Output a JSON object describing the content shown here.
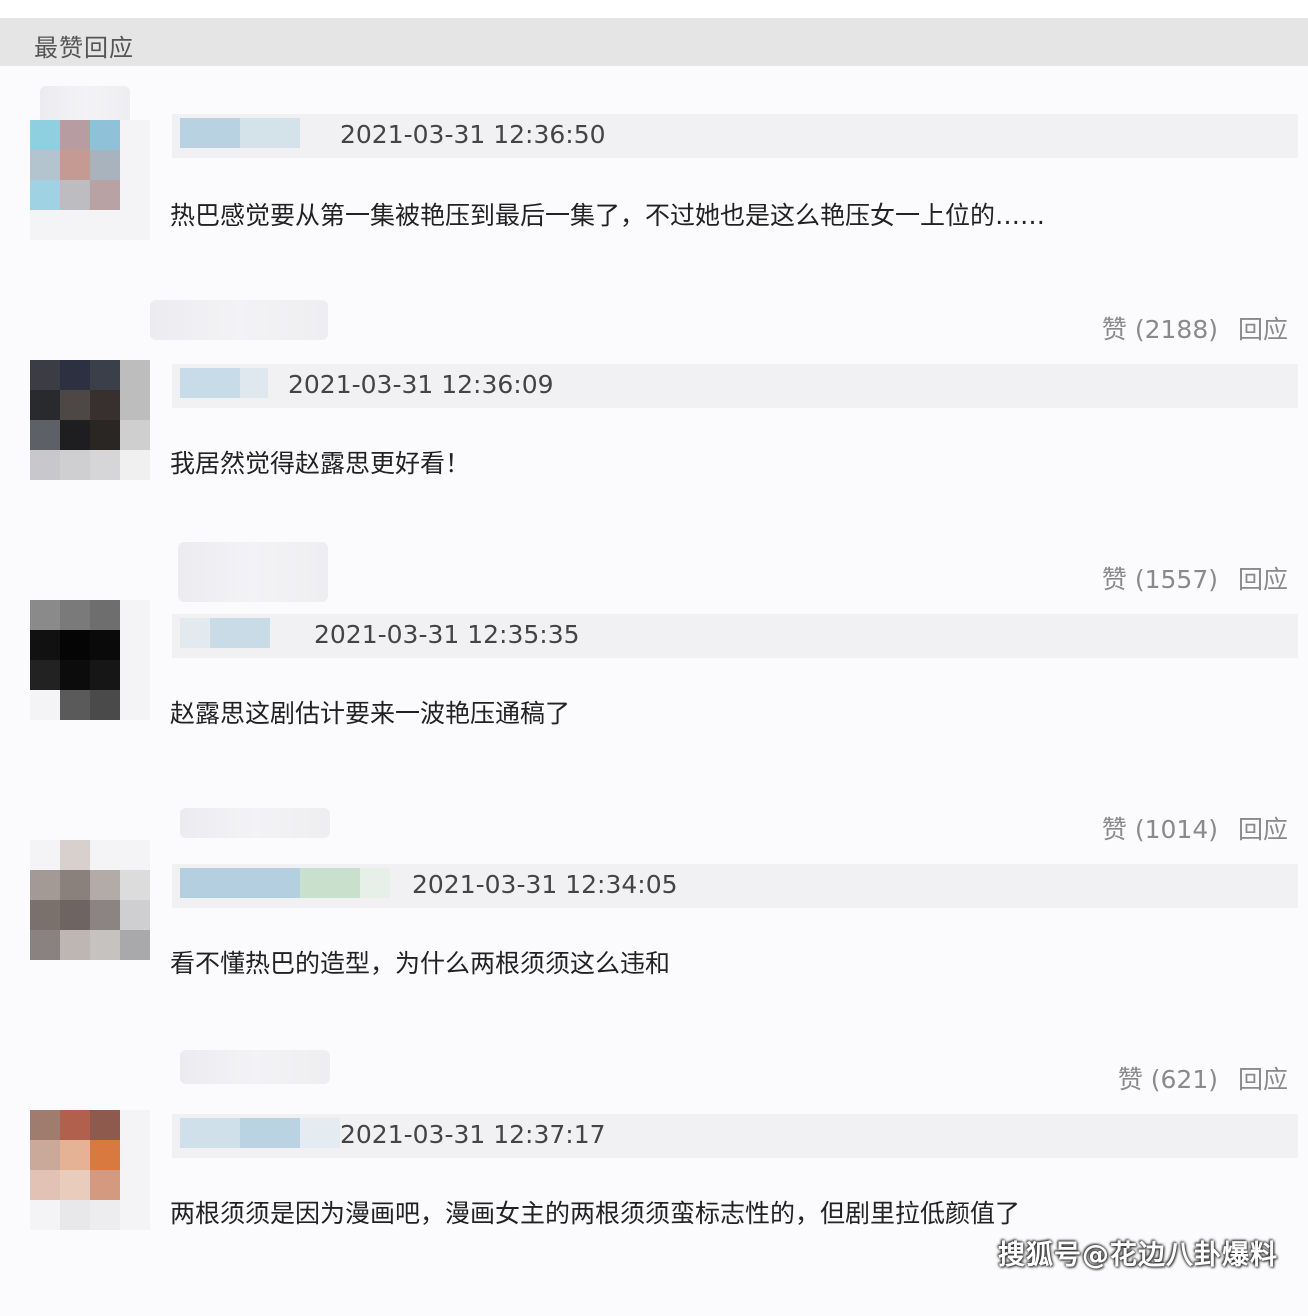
{
  "section_title": "最赞回应",
  "comments": [
    {
      "timestamp": "2021-03-31 12:36:50",
      "text": "热巴感觉要从第一集被艳压到最后一集了，不过她也是这么艳压女一上位的……",
      "likes": "赞 (2188)",
      "reply": "回应"
    },
    {
      "timestamp": "2021-03-31 12:36:09",
      "text": "我居然觉得赵露思更好看！",
      "likes": "赞 (1557)",
      "reply": "回应"
    },
    {
      "timestamp": "2021-03-31 12:35:35",
      "text": "赵露思这剧估计要来一波艳压通稿了",
      "likes": "赞 (1014)",
      "reply": "回应"
    },
    {
      "timestamp": "2021-03-31 12:34:05",
      "text": "看不懂热巴的造型，为什么两根须须这么违和",
      "likes": "赞 (621)",
      "reply": "回应"
    },
    {
      "timestamp": "2021-03-31 12:37:17",
      "text": "两根须须是因为漫画吧，漫画女主的两根须须蛮标志性的，但剧里拉低颜值了"
    }
  ],
  "watermark": "搜狐号@花边八卦爆料"
}
